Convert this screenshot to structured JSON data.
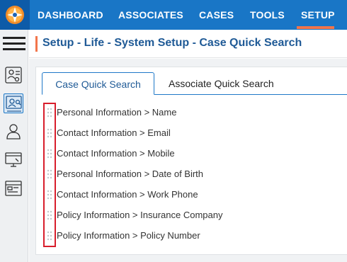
{
  "nav": {
    "items": [
      {
        "label": "DASHBOARD"
      },
      {
        "label": "ASSOCIATES"
      },
      {
        "label": "CASES"
      },
      {
        "label": "TOOLS"
      },
      {
        "label": "SETUP"
      }
    ],
    "active": "SETUP",
    "logo_icon": "compass-star-icon"
  },
  "sidebar": {
    "menu_icon": "hamburger-menu-icon",
    "items": [
      {
        "icon": "associate-settings-icon",
        "active": false
      },
      {
        "icon": "case-search-icon",
        "active": true
      },
      {
        "icon": "user-icon",
        "active": false
      },
      {
        "icon": "monitor-icon",
        "active": false
      },
      {
        "icon": "browser-window-icon",
        "active": false
      }
    ]
  },
  "page": {
    "title": "Setup - Life - System Setup - Case Quick Search"
  },
  "tabs": [
    {
      "label": "Case Quick Search",
      "active": true
    },
    {
      "label": "Associate Quick Search",
      "active": false
    }
  ],
  "search_fields": [
    {
      "label": "Personal Information > Name"
    },
    {
      "label": "Contact Information > Email"
    },
    {
      "label": "Contact Information > Mobile"
    },
    {
      "label": "Personal Information > Date of Birth"
    },
    {
      "label": "Contact Information > Work Phone"
    },
    {
      "label": "Policy Information > Insurance Company"
    },
    {
      "label": "Policy Information > Policy Number"
    }
  ],
  "colors": {
    "nav_bg": "#1976c6",
    "accent": "#f2754b",
    "title": "#1f5a96",
    "highlight": "#d81e2c"
  }
}
